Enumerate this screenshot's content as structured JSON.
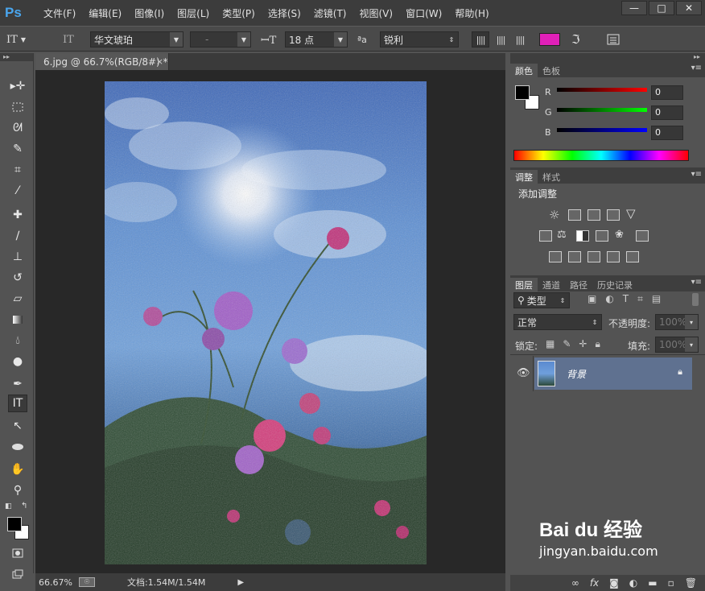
{
  "menu": {
    "logo": "Ps",
    "items": [
      "文件(F)",
      "编辑(E)",
      "图像(I)",
      "图层(L)",
      "类型(P)",
      "选择(S)",
      "滤镜(T)",
      "视图(V)",
      "窗口(W)",
      "帮助(H)"
    ]
  },
  "window_controls": {
    "minimize": "—",
    "restore": "□",
    "close": "✕"
  },
  "options": {
    "font_family": "华文琥珀",
    "font_style": "-",
    "font_size": "18 点",
    "aa_mode": "锐利",
    "text_color": "#e020b8"
  },
  "document": {
    "tab_title": "6.jpg @ 66.7%(RGB/8#) *",
    "close": "×"
  },
  "status": {
    "zoom": "66.67%",
    "doc_size": "文档:1.54M/1.54M"
  },
  "color_panel": {
    "tabs": [
      "颜色",
      "色板"
    ],
    "r_label": "R",
    "g_label": "G",
    "b_label": "B",
    "r_value": "0",
    "g_value": "0",
    "b_value": "0",
    "foreground": "#000000",
    "background": "#ffffff"
  },
  "adjust_panel": {
    "tabs": [
      "调整",
      "样式"
    ],
    "title": "添加调整"
  },
  "layers_panel": {
    "tabs": [
      "图层",
      "通道",
      "路径",
      "历史记录"
    ],
    "filter_kind": "类型",
    "blend_mode": "正常",
    "opacity_label": "不透明度:",
    "opacity_value": "100%",
    "lock_label": "锁定:",
    "fill_label": "填充:",
    "fill_value": "100%",
    "layer_name": "背景"
  },
  "watermark": {
    "brand": "Bai du 经验",
    "url": "jingyan.baidu.com"
  }
}
